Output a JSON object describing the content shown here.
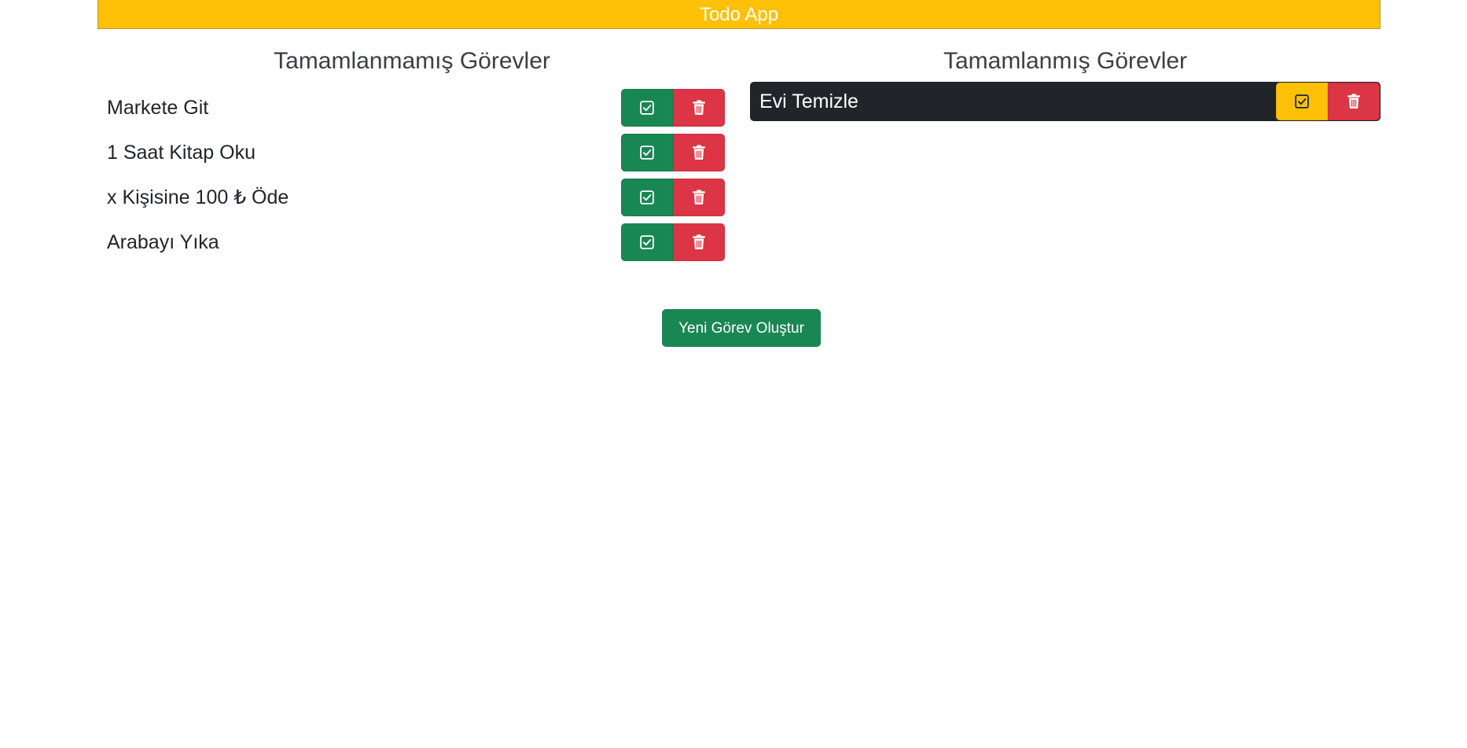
{
  "app": {
    "title": "Todo App",
    "accent_color": "#ffc107"
  },
  "incomplete": {
    "title": "Tamamlanmamış Görevler",
    "items": [
      {
        "label": "Markete Git",
        "complete_icon": "check-square-icon",
        "delete_icon": "trash-icon"
      },
      {
        "label": "1 Saat Kitap Oku",
        "complete_icon": "check-square-icon",
        "delete_icon": "trash-icon"
      },
      {
        "label": "x Kişisine 100 ₺ Öde",
        "complete_icon": "check-square-icon",
        "delete_icon": "trash-icon"
      },
      {
        "label": "Arabayı Yıka",
        "complete_icon": "check-square-icon",
        "delete_icon": "trash-icon"
      }
    ]
  },
  "complete": {
    "title": "Tamamlanmış Görevler",
    "items": [
      {
        "label": "Evi Temizle",
        "undo_icon": "check-square-icon",
        "delete_icon": "trash-icon"
      }
    ]
  },
  "actions": {
    "create_label": "Yeni Görev Oluştur"
  },
  "colors": {
    "success": "#198754",
    "danger": "#dc3545",
    "warning": "#ffc107",
    "dark": "#212529"
  }
}
